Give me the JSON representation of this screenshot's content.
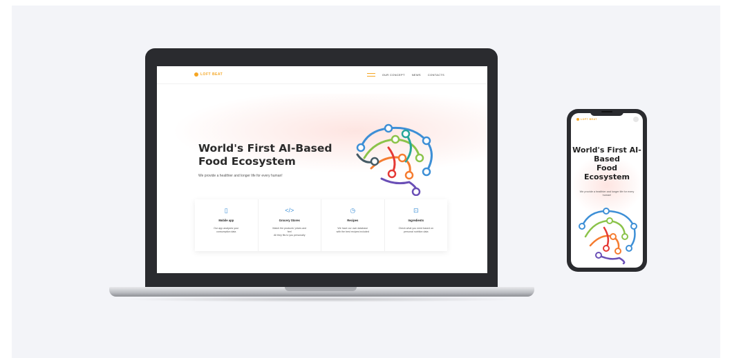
{
  "site": {
    "logo_text": "LOFT BEAT",
    "nav": [
      "OUR CONCEPT",
      "NEWS",
      "CONTACTS"
    ],
    "hero": {
      "title": "World's First AI-Based Food Ecosystem",
      "subtitle": "We provide a healthier and longer life for every human!"
    },
    "features": [
      {
        "icon": "phone-icon",
        "glyph": "▯",
        "title": "Mobile app",
        "desc": "Our app analyzes your\nconsumption data"
      },
      {
        "icon": "code-icon",
        "glyph": "</>",
        "title": "Grocery Stores",
        "desc": "Match the products' prices and\nfeel\nAll they fits to you personally"
      },
      {
        "icon": "clock-icon",
        "glyph": "◷",
        "title": "Recipes",
        "desc": "We have our own database\nwith the best recipes included"
      },
      {
        "icon": "basket-icon",
        "glyph": "⊡",
        "title": "Ingredients",
        "desc": "Check what you need based on\npersonal nutrition data"
      }
    ]
  },
  "phone": {
    "logo_text": "LOFT BEAT",
    "title": "World's First AI-\nBased\nFood\nEcosystem",
    "subtitle": "We provide a healthier and longer life for every human!"
  },
  "colors": {
    "accent": "#f5a623",
    "icon_blue": "#3d8fd6",
    "device_frame": "#2a2b2f"
  }
}
